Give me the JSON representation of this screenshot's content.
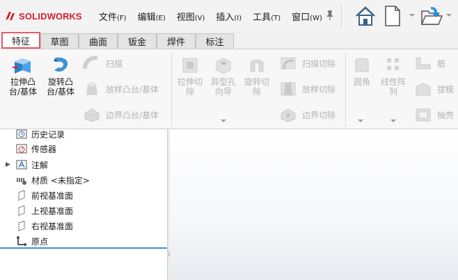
{
  "app": {
    "brand_solid": "SOLID",
    "brand_works": "WORKS"
  },
  "menu": [
    {
      "label": "文件",
      "key": "(F)"
    },
    {
      "label": "编辑",
      "key": "(E)"
    },
    {
      "label": "视图",
      "key": "(V)"
    },
    {
      "label": "插入",
      "key": "(I)"
    },
    {
      "label": "工具",
      "key": "(T)"
    },
    {
      "label": "窗口",
      "key": "(W)"
    }
  ],
  "toolbar_icons": [
    "home-icon",
    "new-document-icon",
    "open-file-icon"
  ],
  "tabs": [
    "特征",
    "草图",
    "曲面",
    "钣金",
    "焊件",
    "标注"
  ],
  "active_tab": "特征",
  "ribbon": {
    "extrude_boss": {
      "line1": "拉伸凸",
      "line2": "台/基体"
    },
    "revolve_boss": {
      "line1": "旋转凸",
      "line2": "台/基体"
    },
    "sweep": "扫描",
    "loft_boss": "放样凸台/基体",
    "boundary_boss": "边界凸台/基体",
    "extrude_cut": {
      "line1": "拉伸切",
      "line2": "除"
    },
    "hole_wizard": {
      "line1": "异型孔",
      "line2": "向导"
    },
    "revolve_cut": {
      "line1": "旋转切",
      "line2": "除"
    },
    "swept_cut": "扫描切除",
    "lofted_cut": "放样切除",
    "boundary_cut": "边界切除",
    "fillet": "圆角",
    "linear_pattern": {
      "line1": "线性阵",
      "line2": "列"
    },
    "rib": "筋",
    "draft": "拔模",
    "shell": "抽壳"
  },
  "tree": {
    "items": [
      {
        "label": "历史记录",
        "icon": "history-icon"
      },
      {
        "label": "传感器",
        "icon": "sensor-icon"
      },
      {
        "label": "注解",
        "icon": "annotation-icon",
        "expandable": true
      },
      {
        "label": "材质 <未指定>",
        "icon": "material-icon"
      },
      {
        "label": "前视基准面",
        "icon": "plane-icon"
      },
      {
        "label": "上视基准面",
        "icon": "plane-icon"
      },
      {
        "label": "右视基准面",
        "icon": "plane-icon"
      },
      {
        "label": "原点",
        "icon": "origin-icon"
      }
    ]
  },
  "colors": {
    "brand": "#d6202c",
    "active_tab_border": "#e35b6a",
    "accent_blue": "#3d8ed6"
  }
}
